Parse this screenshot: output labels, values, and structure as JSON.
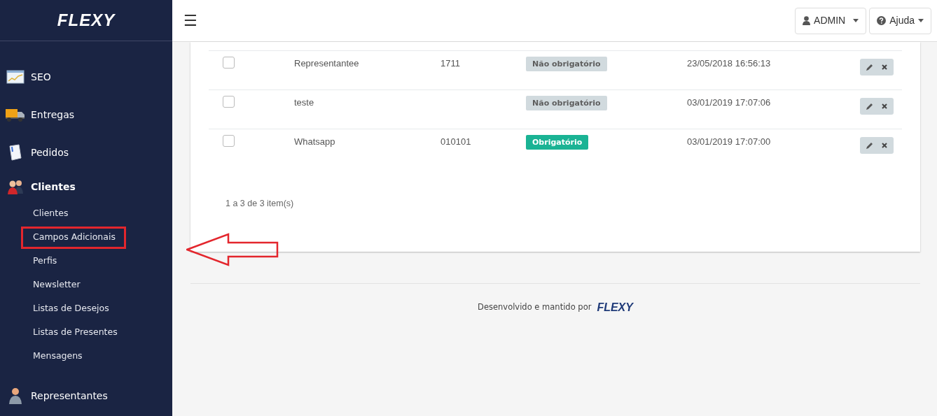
{
  "sidebar": {
    "logo": "FLEXY",
    "items": [
      {
        "label": "SEO",
        "kind": "seo",
        "expanded": false
      },
      {
        "label": "Entregas",
        "kind": "truck",
        "expanded": false
      },
      {
        "label": "Pedidos",
        "kind": "document",
        "expanded": false
      },
      {
        "label": "Clientes",
        "kind": "people",
        "expanded": true,
        "children": [
          {
            "label": "Clientes",
            "highlighted": false
          },
          {
            "label": "Campos Adicionais",
            "highlighted": true
          },
          {
            "label": "Perfis",
            "highlighted": false
          },
          {
            "label": "Newsletter",
            "highlighted": false
          },
          {
            "label": "Listas de Desejos",
            "highlighted": false
          },
          {
            "label": "Listas de Presentes",
            "highlighted": false
          },
          {
            "label": "Mensagens",
            "highlighted": false
          }
        ]
      },
      {
        "label": "Representantes",
        "kind": "person",
        "expanded": false
      }
    ]
  },
  "header": {
    "menu_icon": "☰",
    "user_button": "ADMIN",
    "help_button": "Ajuda"
  },
  "table": {
    "rows": [
      {
        "checked": false,
        "name": "Representantee",
        "code": "1711",
        "required": false,
        "status": "Não obrigatório",
        "date": "23/05/2018 16:56:13"
      },
      {
        "checked": false,
        "name": "teste",
        "code": "",
        "required": false,
        "status": "Não obrigatório",
        "date": "03/01/2019 17:07:06"
      },
      {
        "checked": false,
        "name": "Whatsapp",
        "code": "010101",
        "required": true,
        "status": "Obrigatório",
        "date": "03/01/2019 17:07:00"
      }
    ],
    "pagination": "1 a 3 de 3 item(s)"
  },
  "footer": {
    "text": "Desenvolvido e mantido por",
    "logo": "FLEXY"
  }
}
